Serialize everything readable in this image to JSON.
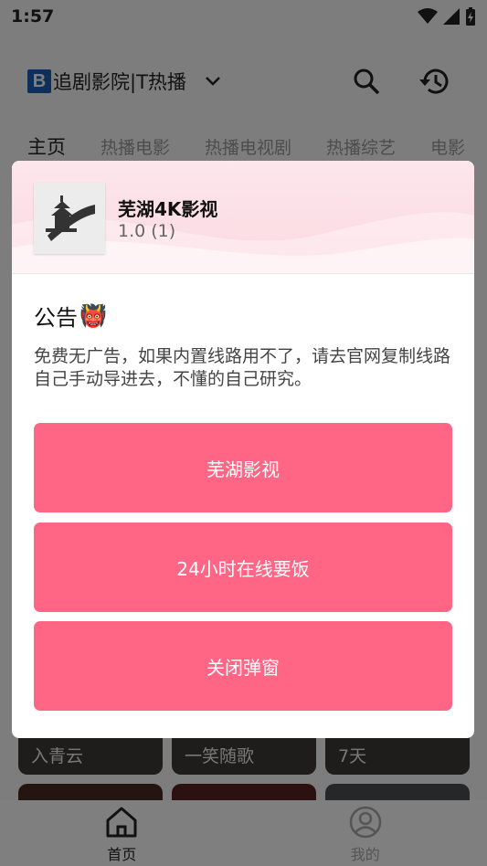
{
  "status_bar": {
    "time": "1:57"
  },
  "app_bar": {
    "logo_letter": "B",
    "title": "追剧影院|T热播"
  },
  "tabs": [
    {
      "label": "主页"
    },
    {
      "label": "热播电影"
    },
    {
      "label": "热播电视剧"
    },
    {
      "label": "热播综艺"
    },
    {
      "label": "电影"
    }
  ],
  "cards": [
    {
      "title": "入青云"
    },
    {
      "title": "一笑随歌"
    },
    {
      "title": "7天"
    }
  ],
  "bottom_nav": [
    {
      "label": "首页"
    },
    {
      "label": "我的"
    }
  ],
  "dialog": {
    "app_name": "芜湖4K影视",
    "version": "1.0 (1)",
    "notice_title": "公告",
    "notice_emoji": "👹",
    "notice_text": "免费无广告，如果内置线路用不了，请去官网复制线路自己手动导进去，不懂的自己研究。",
    "buttons": [
      {
        "label": "芜湖影视"
      },
      {
        "label": "24小时在线要饭"
      },
      {
        "label": "关闭弹窗"
      }
    ]
  },
  "colors": {
    "accent": "#ff6685",
    "header_tint": "#fde6ec",
    "logo_blue": "#1f5fb7"
  }
}
